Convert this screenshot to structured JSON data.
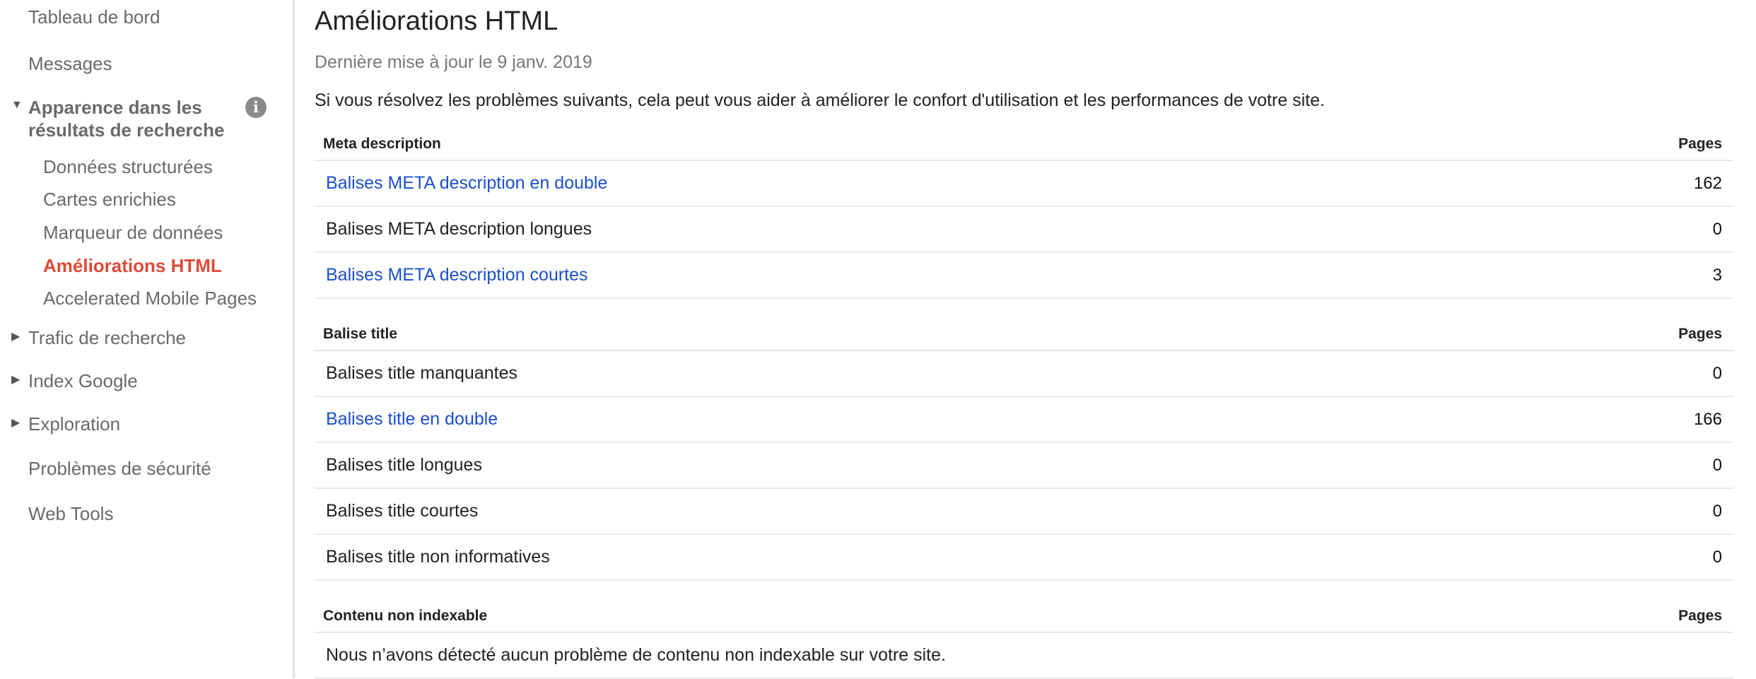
{
  "sidebar": {
    "items": [
      {
        "label": "Tableau de bord"
      },
      {
        "label": "Messages"
      },
      {
        "label": "Apparence dans les",
        "label2": "résultats de recherche"
      },
      {
        "label": "Données structurées"
      },
      {
        "label": "Cartes enrichies"
      },
      {
        "label": "Marqueur de données"
      },
      {
        "label": "Améliorations HTML"
      },
      {
        "label": "Accelerated Mobile Pages"
      },
      {
        "label": "Trafic de recherche"
      },
      {
        "label": "Index Google"
      },
      {
        "label": "Exploration"
      },
      {
        "label": "Problèmes de sécurité"
      },
      {
        "label": "Web Tools"
      }
    ],
    "info_icon": "i",
    "active_color": "#dd4b39"
  },
  "main": {
    "title": "Améliorations HTML",
    "updated": "Dernière mise à jour le 9 janv. 2019",
    "intro": "Si vous résolvez les problèmes suivants, cela peut vous aider à améliorer le confort d'utilisation et les performances de votre site.",
    "sections": [
      {
        "header": "Meta description",
        "pages": "Pages",
        "rows": [
          {
            "label": "Balises META description en double",
            "value": "162",
            "link": true
          },
          {
            "label": "Balises META description longues",
            "value": "0",
            "link": false
          },
          {
            "label": "Balises META description courtes",
            "value": "3",
            "link": true
          }
        ]
      },
      {
        "header": "Balise title",
        "pages": "Pages",
        "rows": [
          {
            "label": "Balises title manquantes",
            "value": "0",
            "link": false
          },
          {
            "label": "Balises title en double",
            "value": "166",
            "link": true
          },
          {
            "label": "Balises title longues",
            "value": "0",
            "link": false
          },
          {
            "label": "Balises title courtes",
            "value": "0",
            "link": false
          },
          {
            "label": "Balises title non informatives",
            "value": "0",
            "link": false
          }
        ]
      },
      {
        "header": "Contenu non indexable",
        "pages": "Pages",
        "rows": [
          {
            "label": "Nous n’avons détecté aucun problème de contenu non indexable sur votre site.",
            "value": "",
            "link": false
          }
        ]
      }
    ],
    "link_color": "#1a4fcf"
  }
}
